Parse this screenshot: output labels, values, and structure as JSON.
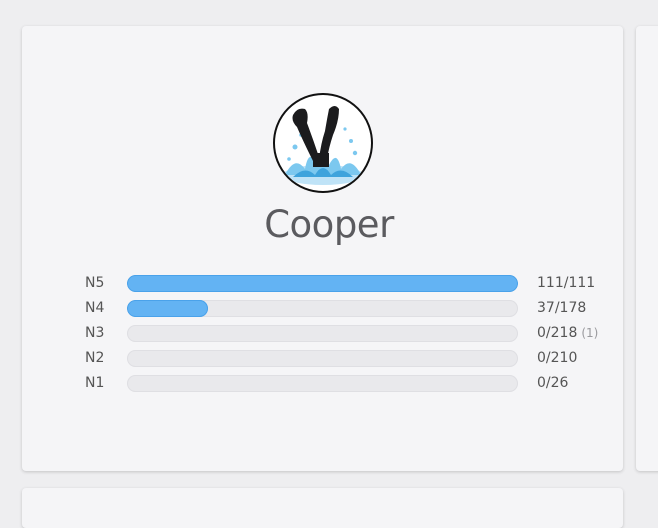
{
  "profile": {
    "username": "Cooper",
    "avatar": "legs-diving-into-water-splash-image"
  },
  "levels": [
    {
      "label": "N5",
      "count": "111/111",
      "progress": 1.0,
      "extra": ""
    },
    {
      "label": "N4",
      "count": "37/178",
      "progress": 0.208,
      "extra": ""
    },
    {
      "label": "N3",
      "count": "0/218",
      "progress": 0.0,
      "extra": "(1)"
    },
    {
      "label": "N2",
      "count": "0/210",
      "progress": 0.0,
      "extra": ""
    },
    {
      "label": "N1",
      "count": "0/26",
      "progress": 0.0,
      "extra": ""
    }
  ],
  "colors": {
    "bar_fill": "#63b3f3",
    "bar_track": "#e9e9ec",
    "card_background": "#f5f5f7",
    "page_background": "#eeeef0"
  }
}
